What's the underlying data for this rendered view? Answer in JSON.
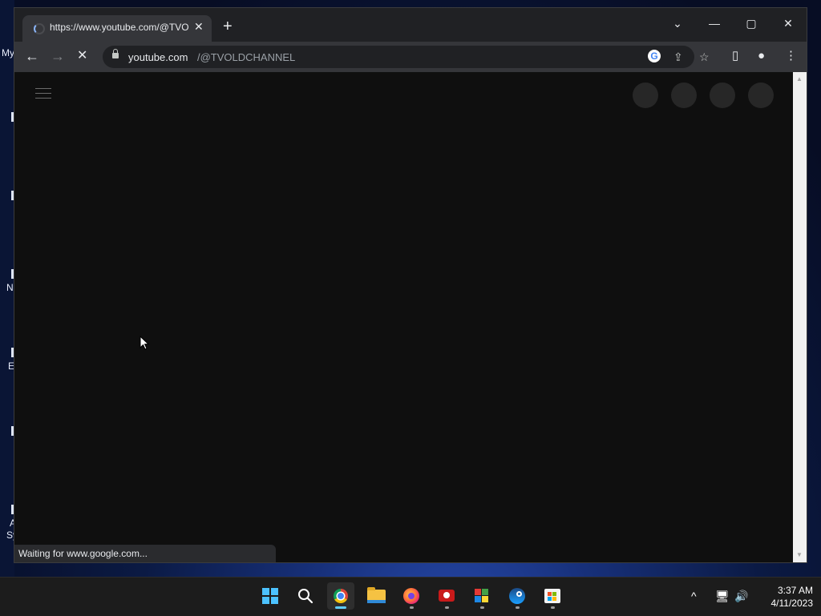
{
  "desktop": {
    "icon_labels": [
      "My",
      "N",
      "E",
      "A",
      "Sy"
    ]
  },
  "browser": {
    "tab": {
      "title": "https://www.youtube.com/@TVOLDCHANNEL",
      "close_glyph": "✕",
      "state": "loading"
    },
    "new_tab_glyph": "+",
    "window_controls": {
      "tab_search": "⌄",
      "minimize": "—",
      "maximize": "▢",
      "close": "✕"
    },
    "nav": {
      "back": "←",
      "forward": "→",
      "stop": "✕"
    },
    "omnibox": {
      "host": "youtube.com",
      "path": "/@TVOLDCHANNEL"
    },
    "omnibox_icons": [
      "google-lens-icon",
      "share-icon",
      "bookmark-star-icon"
    ],
    "toolbar_icons": [
      "side-panel-icon",
      "profile-icon",
      "menu-icon"
    ],
    "status_text": "Waiting for www.google.com...",
    "page": {
      "background": "#0f0f0f",
      "skeleton_avatar_count": 4
    }
  },
  "taskbar": {
    "apps": [
      {
        "name": "start",
        "icon": "windows-logo-icon",
        "running": false
      },
      {
        "name": "search",
        "icon": "search-icon",
        "running": false
      },
      {
        "name": "chrome",
        "icon": "chrome-icon",
        "running": true,
        "active": true
      },
      {
        "name": "file-explorer",
        "icon": "folder-icon",
        "running": false
      },
      {
        "name": "firefox",
        "icon": "firefox-icon",
        "running": true
      },
      {
        "name": "screen-recorder",
        "icon": "recorder-icon",
        "running": true
      },
      {
        "name": "app-flag",
        "icon": "flag-app-icon",
        "running": true
      },
      {
        "name": "steam",
        "icon": "steam-icon",
        "running": true
      },
      {
        "name": "microsoft-store",
        "icon": "store-icon",
        "running": true
      }
    ],
    "tray": {
      "chevron": "^",
      "network": "🖥",
      "volume": "🔊"
    },
    "clock": {
      "time": "3:37 AM",
      "date": "4/11/2023"
    }
  },
  "colors": {
    "accent": "#60cdff",
    "chrome_frame": "#202124",
    "chrome_toolbar": "#35363a",
    "youtube_dark": "#0f0f0f"
  }
}
